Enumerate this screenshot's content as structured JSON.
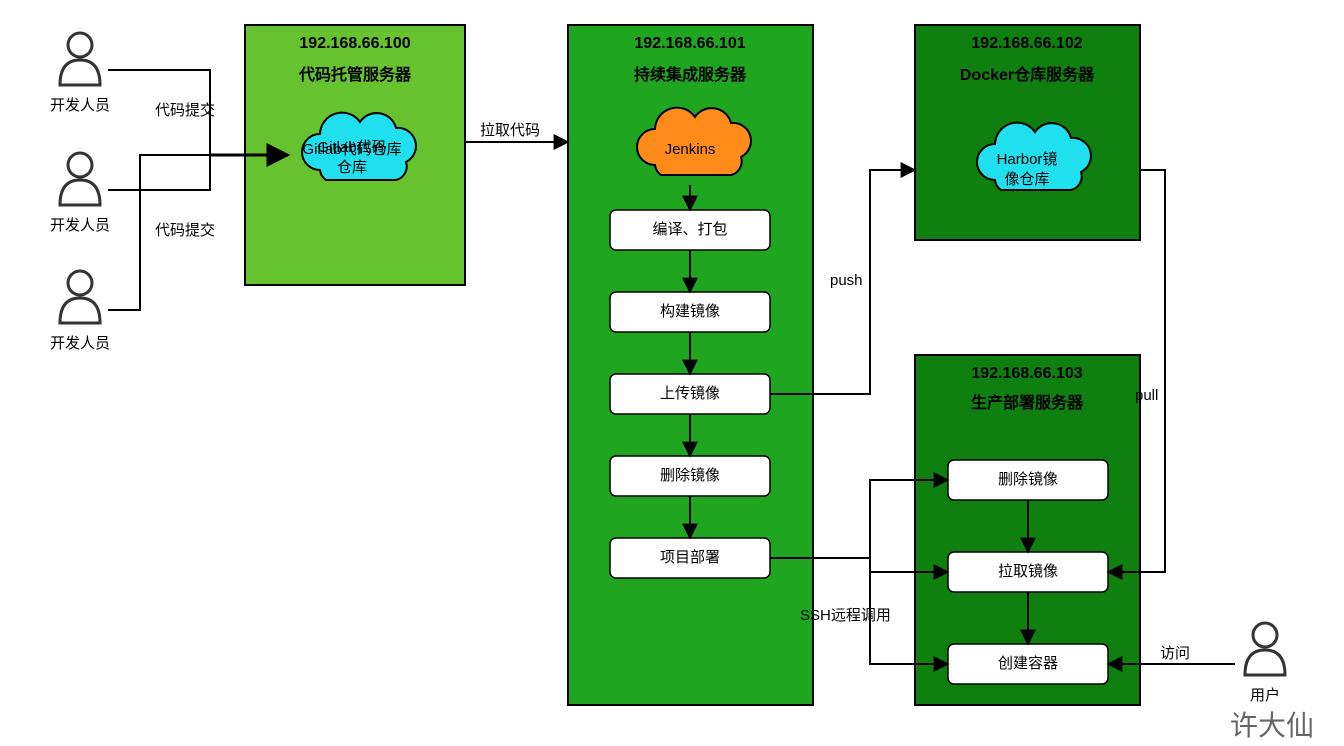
{
  "developers": [
    {
      "label": "开发人员"
    },
    {
      "label": "开发人员"
    },
    {
      "label": "开发人员"
    }
  ],
  "commit_labels": [
    "代码提交",
    "代码提交"
  ],
  "servers": {
    "code": {
      "ip": "192.168.66.100",
      "title": "代码托管服务器",
      "cloud": "Gitlab代码仓库"
    },
    "ci": {
      "ip": "192.168.66.101",
      "title": "持续集成服务器",
      "cloud": "Jenkins",
      "steps": [
        "编译、打包",
        "构建镜像",
        "上传镜像",
        "删除镜像",
        "项目部署"
      ]
    },
    "reg": {
      "ip": "192.168.66.102",
      "title": "Docker仓库服务器",
      "cloud": "Harbor镜像仓库"
    },
    "prod": {
      "ip": "192.168.66.103",
      "title": "生产部署服务器",
      "steps": [
        "删除镜像",
        "拉取镜像",
        "创建容器"
      ]
    }
  },
  "edges": {
    "pull_code": "拉取代码",
    "push": "push",
    "pull": "pull",
    "ssh": "SSH远程调用",
    "visit": "访问"
  },
  "user_label": "用户",
  "watermark": "许大仙"
}
